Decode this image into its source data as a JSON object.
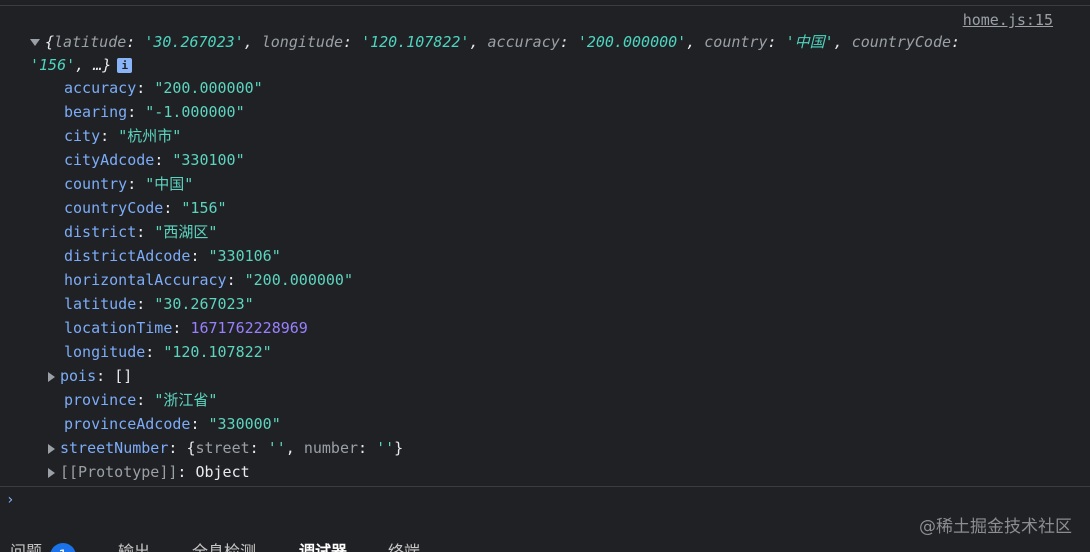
{
  "source_link": "home.js:15",
  "summary": {
    "open": "{",
    "pairs": [
      {
        "key": "latitude",
        "value": "'30.267023'"
      },
      {
        "key": "longitude",
        "value": "'120.107822'"
      },
      {
        "key": "accuracy",
        "value": "'200.000000'"
      },
      {
        "key": "country",
        "value": "'中国'"
      },
      {
        "key": "countryCode",
        "value": "'156'"
      }
    ],
    "ellipsis": "…}",
    "info_glyph": "i"
  },
  "properties": [
    {
      "key": "accuracy",
      "value": "\"200.000000\""
    },
    {
      "key": "bearing",
      "value": "\"-1.000000\""
    },
    {
      "key": "city",
      "value": "\"杭州市\""
    },
    {
      "key": "cityAdcode",
      "value": "\"330100\""
    },
    {
      "key": "country",
      "value": "\"中国\""
    },
    {
      "key": "countryCode",
      "value": "\"156\""
    },
    {
      "key": "district",
      "value": "\"西湖区\""
    },
    {
      "key": "districtAdcode",
      "value": "\"330106\""
    },
    {
      "key": "horizontalAccuracy",
      "value": "\"200.000000\""
    },
    {
      "key": "latitude",
      "value": "\"30.267023\""
    },
    {
      "key": "locationTime",
      "value": "1671762228969"
    },
    {
      "key": "longitude",
      "value": "\"120.107822\""
    },
    {
      "key": "pois",
      "value": "[]"
    },
    {
      "key": "province",
      "value": "\"浙江省\""
    },
    {
      "key": "provinceAdcode",
      "value": "\"330000\""
    },
    {
      "key": "streetNumber",
      "open": "{",
      "k1": "street",
      "v1": "''",
      "k2": "number",
      "v2": "''",
      "close": "}"
    },
    {
      "key": "[[Prototype]]",
      "value": "Object"
    }
  ],
  "prompt_glyph": "›",
  "watermark": "@稀土掘金技术社区",
  "tabs": [
    {
      "label": "问题",
      "badge": "1"
    },
    {
      "label": "输出"
    },
    {
      "label": "全息检测"
    },
    {
      "label": "调试器"
    },
    {
      "label": "终端"
    }
  ]
}
